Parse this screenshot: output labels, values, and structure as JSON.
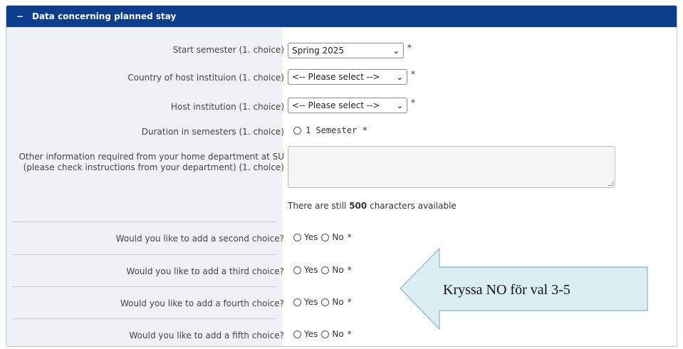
{
  "section": {
    "toggle": "−",
    "title": "Data concerning planned stay"
  },
  "fields": {
    "start_semester": {
      "label": "Start semester (1. choice)",
      "value": "Spring 2025",
      "required": "*"
    },
    "country": {
      "label": "Country of host instituion (1. choice)",
      "value": "<-- Please select -->",
      "required": "*"
    },
    "host": {
      "label": "Host institution (1. choice)",
      "value": "<-- Please select -->",
      "required": "*"
    },
    "duration": {
      "label": "Duration in semesters (1. choice)",
      "option": "1 Semester",
      "required": "*"
    },
    "other_info": {
      "label": "Other information required from your home department at SU (please check instructions from your department) (1. choice)",
      "char_prefix": "There are still",
      "char_count": "500",
      "char_suffix": "characters available"
    }
  },
  "choices": [
    {
      "label": "Would you like to add a second choice?",
      "yes": "Yes",
      "no": "No",
      "required": "*"
    },
    {
      "label": "Would you like to add a third choice?",
      "yes": "Yes",
      "no": "No",
      "required": "*"
    },
    {
      "label": "Would you like to add a fourth choice?",
      "yes": "Yes",
      "no": "No",
      "required": "*"
    },
    {
      "label": "Would you like to add a fifth choice?",
      "yes": "Yes",
      "no": "No",
      "required": "*"
    }
  ],
  "callout": {
    "text": "Kryssa NO för val 3-5",
    "fill": "#daeef3",
    "stroke": "#8ab4c4"
  },
  "colors": {
    "header": "#0b3e8c",
    "panel": "#eef2f7"
  }
}
